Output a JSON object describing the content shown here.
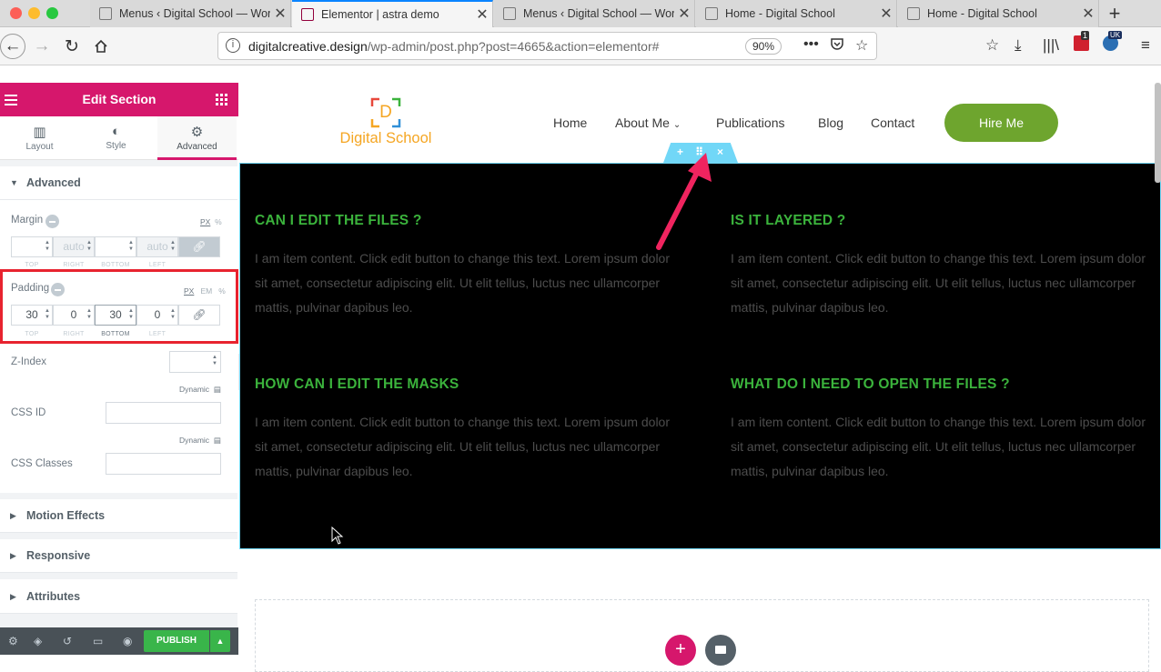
{
  "browser": {
    "tabs": [
      {
        "title": "Menus ‹ Digital School — Wor",
        "active": false
      },
      {
        "title": "Elementor | astra demo",
        "active": true
      },
      {
        "title": "Menus ‹ Digital School — Wor",
        "active": false
      },
      {
        "title": "Home - Digital School",
        "active": false
      },
      {
        "title": "Home - Digital School",
        "active": false
      }
    ],
    "tab_close": "✕",
    "new_tab": "+",
    "url_host": "digitalcreative.design",
    "url_path": "/wp-admin/post.php?post=4665&action=elementor#",
    "zoom": "90%",
    "ext_badge": "1",
    "ext_badge_uk": "UK"
  },
  "panel": {
    "title": "Edit Section",
    "tabs": [
      {
        "label": "Layout",
        "icon": "columns-icon"
      },
      {
        "label": "Style",
        "icon": "half-circle-icon"
      },
      {
        "label": "Advanced",
        "icon": "gear-icon"
      }
    ],
    "sections": {
      "advanced": "Advanced",
      "motion": "Motion Effects",
      "responsive": "Responsive",
      "attributes": "Attributes"
    },
    "margin": {
      "label": "Margin",
      "unit_px": "PX",
      "unit_pct": "%",
      "top": "",
      "right": "auto",
      "bottom": "",
      "left": "auto",
      "labels": [
        "TOP",
        "RIGHT",
        "BOTTOM",
        "LEFT"
      ]
    },
    "padding": {
      "label": "Padding",
      "unit_px": "PX",
      "unit_em": "EM",
      "unit_pct": "%",
      "top": "30",
      "right": "0",
      "bottom": "30",
      "left": "0",
      "labels": [
        "TOP",
        "RIGHT",
        "BOTTOM",
        "LEFT"
      ]
    },
    "zindex": {
      "label": "Z-Index",
      "value": "",
      "dynamic": "Dynamic"
    },
    "css_id": {
      "label": "CSS ID",
      "value": "",
      "dynamic": "Dynamic"
    },
    "css_classes": {
      "label": "CSS Classes",
      "value": ""
    },
    "footer": {
      "publish": "PUBLISH"
    }
  },
  "site": {
    "logo_letter": "D",
    "logo_text": "Digital School",
    "menu": [
      "Home",
      "About Me",
      "Publications",
      "Blog",
      "Contact"
    ],
    "cta": "Hire Me",
    "faq": [
      {
        "q": "CAN I EDIT THE FILES ?",
        "a": "I am item content. Click edit button to change this text. Lorem ipsum dolor sit amet, consectetur adipiscing elit. Ut elit tellus, luctus nec ullamcorper mattis, pulvinar dapibus leo."
      },
      {
        "q": "IS IT LAYERED ?",
        "a": "I am item content. Click edit button to change this text. Lorem ipsum dolor sit amet, consectetur adipiscing elit. Ut elit tellus, luctus nec ullamcorper mattis, pulvinar dapibus leo."
      },
      {
        "q": "HOW CAN I EDIT THE MASKS",
        "a": "I am item content. Click edit button to change this text. Lorem ipsum dolor sit amet, consectetur adipiscing elit. Ut elit tellus, luctus nec ullamcorper mattis, pulvinar dapibus leo."
      },
      {
        "q": "WHAT DO I NEED TO OPEN THE FILES ?",
        "a": "I am item content. Click edit button to change this text. Lorem ipsum dolor sit amet, consectetur adipiscing elit. Ut elit tellus, luctus nec ullamcorper mattis, pulvinar dapibus leo."
      }
    ],
    "handle": {
      "add": "+",
      "move": "⠿",
      "close": "×"
    },
    "add_section": "+"
  },
  "colors": {
    "elementor_pink": "#d6176c",
    "section_black": "#000000",
    "faq_green": "#3bb33c",
    "cta_green": "#6ea52e",
    "logo_orange": "#f5a623",
    "highlight_red": "#e8232f",
    "arrow": "#f0245f"
  }
}
